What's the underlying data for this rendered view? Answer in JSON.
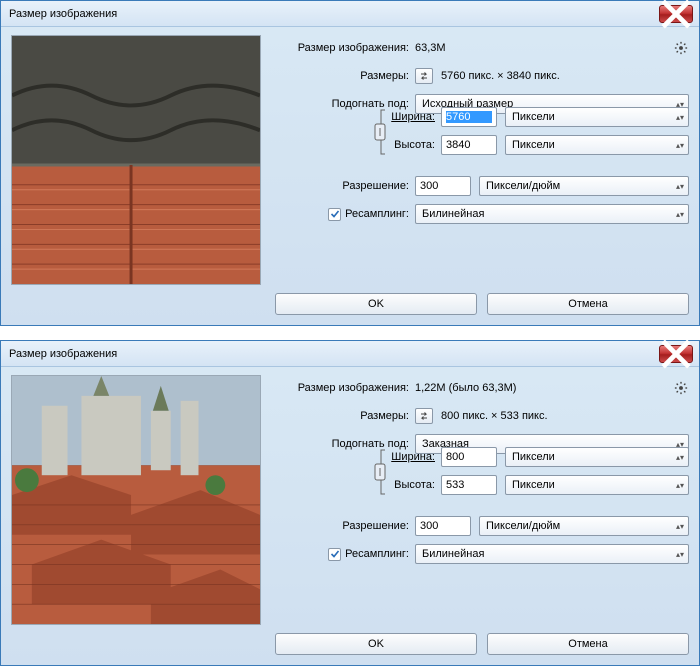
{
  "dialog1": {
    "title": "Размер изображения",
    "size_label": "Размер изображения:",
    "size_value": "63,3M",
    "dims_label": "Размеры:",
    "dims_value": "5760 пикс. × 3840 пикс.",
    "fit_label": "Подогнать под:",
    "fit_value": "Исходный размер",
    "width_label": "Ширина:",
    "width_value": "5760",
    "width_unit": "Пиксели",
    "height_label": "Высота:",
    "height_value": "3840",
    "height_unit": "Пиксели",
    "resolution_label": "Разрешение:",
    "resolution_value": "300",
    "resolution_unit": "Пиксели/дюйм",
    "resample_label": "Ресамплинг:",
    "resample_value": "Билинейная",
    "ok": "OK",
    "cancel": "Отмена"
  },
  "dialog2": {
    "title": "Размер изображения",
    "size_label": "Размер изображения:",
    "size_value": "1,22M (было 63,3M)",
    "dims_label": "Размеры:",
    "dims_value": "800 пикс. × 533 пикс.",
    "fit_label": "Подогнать под:",
    "fit_value": "Заказная",
    "width_label": "Ширина:",
    "width_value": "800",
    "width_unit": "Пиксели",
    "height_label": "Высота:",
    "height_value": "533",
    "height_unit": "Пиксели",
    "resolution_label": "Разрешение:",
    "resolution_value": "300",
    "resolution_unit": "Пиксели/дюйм",
    "resample_label": "Ресамплинг:",
    "resample_value": "Билинейная",
    "ok": "OK",
    "cancel": "Отмена"
  }
}
